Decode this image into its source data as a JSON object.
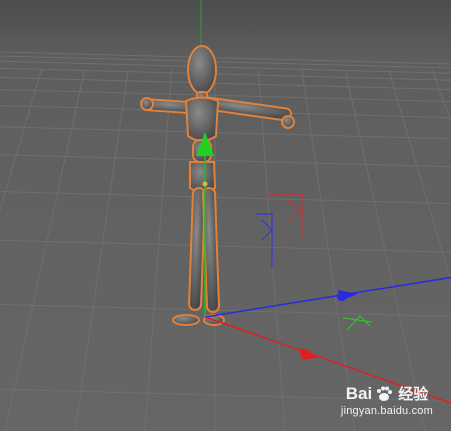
{
  "viewport": {
    "background_color": "#616161",
    "grid_color": "#6f6f6f"
  },
  "model": {
    "type": "wooden mannequin figure",
    "pose": "T-pose",
    "body_color": "#6b6b6b",
    "selection_outline_color": "#e0823a"
  },
  "gizmo": {
    "x_axis_color": "#e02020",
    "y_axis_color": "#20d020",
    "z_axis_color": "#2a2ae0"
  },
  "watermark": {
    "brand": "Bai",
    "brand_icon": "paw-icon",
    "text_cn": "经验",
    "url": "jingyan.baidu.com"
  }
}
